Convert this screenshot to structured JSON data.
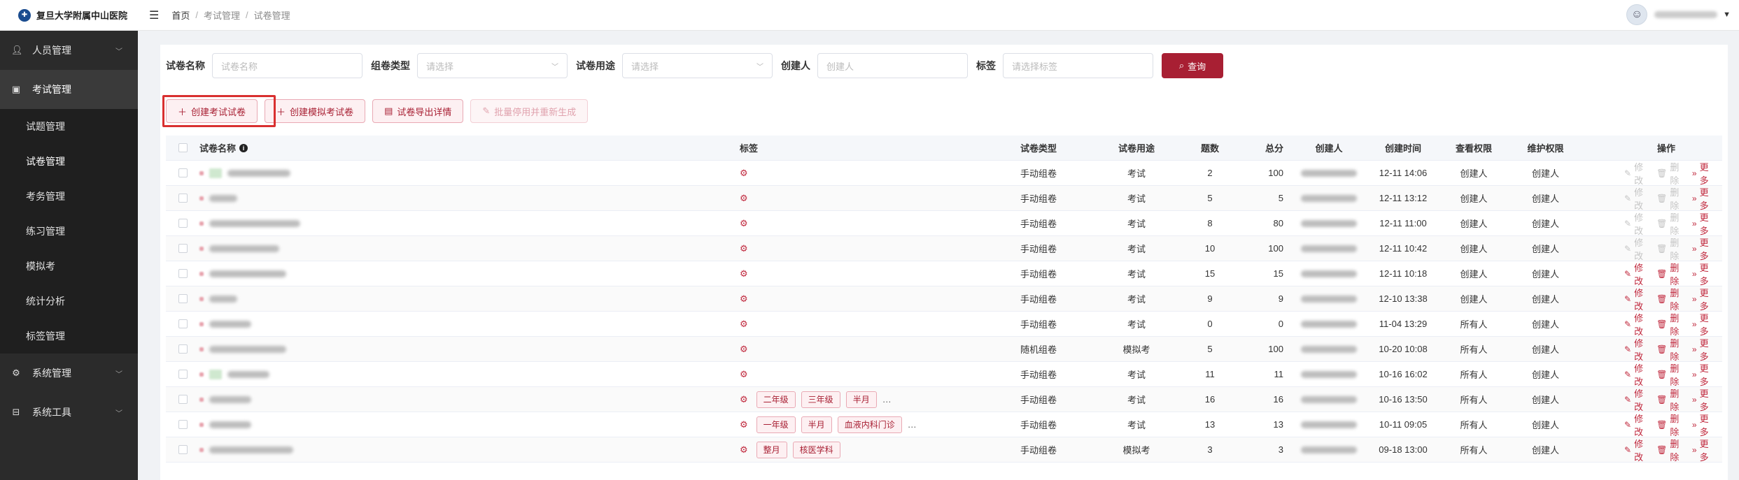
{
  "brand": {
    "name": "复旦大学附属中山医院",
    "logo_icon": "hospital-shield-icon"
  },
  "breadcrumb": [
    "首页",
    "考试管理",
    "试卷管理"
  ],
  "sidebar": {
    "groups": [
      {
        "label": "人员管理",
        "icon": "user-icon"
      },
      {
        "label": "考试管理",
        "icon": "exam-icon"
      },
      {
        "label": "系统管理",
        "icon": "gear-icon"
      },
      {
        "label": "系统工具",
        "icon": "toolbox-icon"
      }
    ],
    "exam_sub": [
      "试题管理",
      "试卷管理",
      "考务管理",
      "练习管理",
      "模拟考",
      "统计分析",
      "标签管理"
    ]
  },
  "filters": {
    "name_label": "试卷名称",
    "name_placeholder": "试卷名称",
    "group_label": "组卷类型",
    "group_placeholder": "请选择",
    "use_label": "试卷用途",
    "use_placeholder": "请选择",
    "creator_label": "创建人",
    "creator_placeholder": "创建人",
    "tag_label": "标签",
    "tag_placeholder": "请选择标签",
    "query_label": "查询"
  },
  "actions": {
    "create_exam": "创建考试试卷",
    "create_mock": "创建模拟考试卷",
    "export": "试卷导出详情",
    "batch": "批量停用并重新生成"
  },
  "table": {
    "headers": {
      "name": "试卷名称",
      "tag": "标签",
      "type": "试卷类型",
      "use": "试卷用途",
      "count": "题数",
      "score": "总分",
      "creator": "创建人",
      "time": "创建时间",
      "view": "查看权限",
      "maint": "维护权限",
      "op": "操作"
    },
    "op_labels": {
      "edit": "修改",
      "delete": "删除",
      "more": "更多"
    },
    "rows": [
      {
        "type": "手动组卷",
        "use": "考试",
        "count": "2",
        "score": "100",
        "time": "12-11 14:06",
        "view": "创建人",
        "maint": "创建人",
        "tags": [],
        "ops_enabled": false
      },
      {
        "type": "手动组卷",
        "use": "考试",
        "count": "5",
        "score": "5",
        "time": "12-11 13:12",
        "view": "创建人",
        "maint": "创建人",
        "tags": [],
        "ops_enabled": false
      },
      {
        "type": "手动组卷",
        "use": "考试",
        "count": "8",
        "score": "80",
        "time": "12-11 11:00",
        "view": "创建人",
        "maint": "创建人",
        "tags": [],
        "ops_enabled": false
      },
      {
        "type": "手动组卷",
        "use": "考试",
        "count": "10",
        "score": "100",
        "time": "12-11 10:42",
        "view": "创建人",
        "maint": "创建人",
        "tags": [],
        "ops_enabled": false
      },
      {
        "type": "手动组卷",
        "use": "考试",
        "count": "15",
        "score": "15",
        "time": "12-11 10:18",
        "view": "创建人",
        "maint": "创建人",
        "tags": [],
        "ops_enabled": true
      },
      {
        "type": "手动组卷",
        "use": "考试",
        "count": "9",
        "score": "9",
        "time": "12-10 13:38",
        "view": "创建人",
        "maint": "创建人",
        "tags": [],
        "ops_enabled": true
      },
      {
        "type": "手动组卷",
        "use": "考试",
        "count": "0",
        "score": "0",
        "time": "11-04 13:29",
        "view": "所有人",
        "maint": "创建人",
        "tags": [],
        "ops_enabled": true
      },
      {
        "type": "随机组卷",
        "use": "模拟考",
        "count": "5",
        "score": "100",
        "time": "10-20 10:08",
        "view": "所有人",
        "maint": "创建人",
        "tags": [],
        "ops_enabled": true
      },
      {
        "type": "手动组卷",
        "use": "考试",
        "count": "11",
        "score": "11",
        "time": "10-16 16:02",
        "view": "所有人",
        "maint": "创建人",
        "tags": [],
        "ops_enabled": true
      },
      {
        "type": "手动组卷",
        "use": "考试",
        "count": "16",
        "score": "16",
        "time": "10-16 13:50",
        "view": "所有人",
        "maint": "创建人",
        "tags": [
          "二年级",
          "三年级",
          "半月"
        ],
        "ops_enabled": true
      },
      {
        "type": "手动组卷",
        "use": "考试",
        "count": "13",
        "score": "13",
        "time": "10-11 09:05",
        "view": "所有人",
        "maint": "创建人",
        "tags": [
          "一年级",
          "半月",
          "血液内科门诊"
        ],
        "ops_enabled": true
      },
      {
        "type": "手动组卷",
        "use": "模拟考",
        "count": "3",
        "score": "3",
        "time": "09-18 13:00",
        "view": "所有人",
        "maint": "创建人",
        "tags": [
          "整月",
          "核医学科"
        ],
        "ops_enabled": true
      }
    ]
  }
}
